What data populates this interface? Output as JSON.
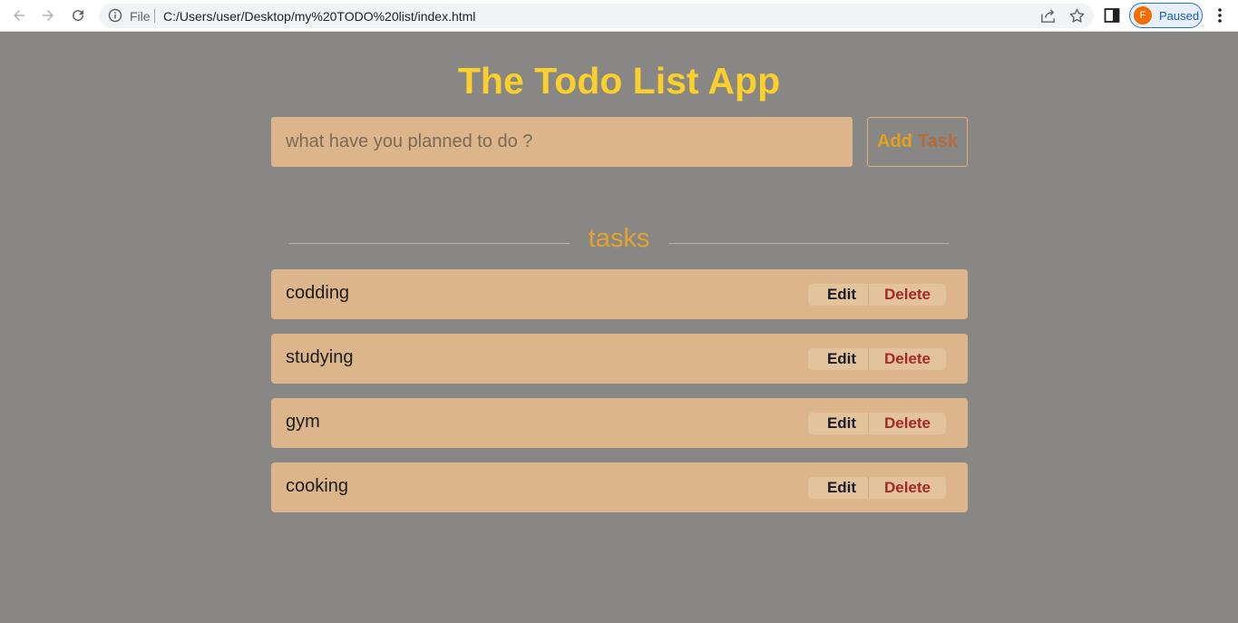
{
  "browser": {
    "file_label": "File",
    "url": "C:/Users/user/Desktop/my%20TODO%20list/index.html",
    "profile_initial": "F",
    "profile_status": "Paused",
    "icons": [
      "back-arrow-icon",
      "forward-arrow-icon",
      "reload-icon",
      "info-icon",
      "share-icon",
      "star-icon",
      "side-panel-icon",
      "more-menu-icon"
    ]
  },
  "app": {
    "title": "The Todo List App",
    "input_placeholder": "what have you planned to do ?",
    "add_button": {
      "word1": "Add",
      "word2": "Task"
    },
    "tasks_heading": "tasks",
    "tasks": [
      {
        "name": "codding",
        "edit_label": "Edit",
        "delete_label": "Delete"
      },
      {
        "name": "studying",
        "edit_label": "Edit",
        "delete_label": "Delete"
      },
      {
        "name": "gym",
        "edit_label": "Edit",
        "delete_label": "Delete"
      },
      {
        "name": "cooking",
        "edit_label": "Edit",
        "delete_label": "Delete"
      }
    ]
  },
  "colors": {
    "page_background": "#888786",
    "title": "#fbd02a",
    "card": "#dcb68a",
    "add_word": "#e5a01f",
    "task_word": "#b46b3b",
    "tasks_heading": "#e1a32a",
    "delete": "#a5292a"
  }
}
